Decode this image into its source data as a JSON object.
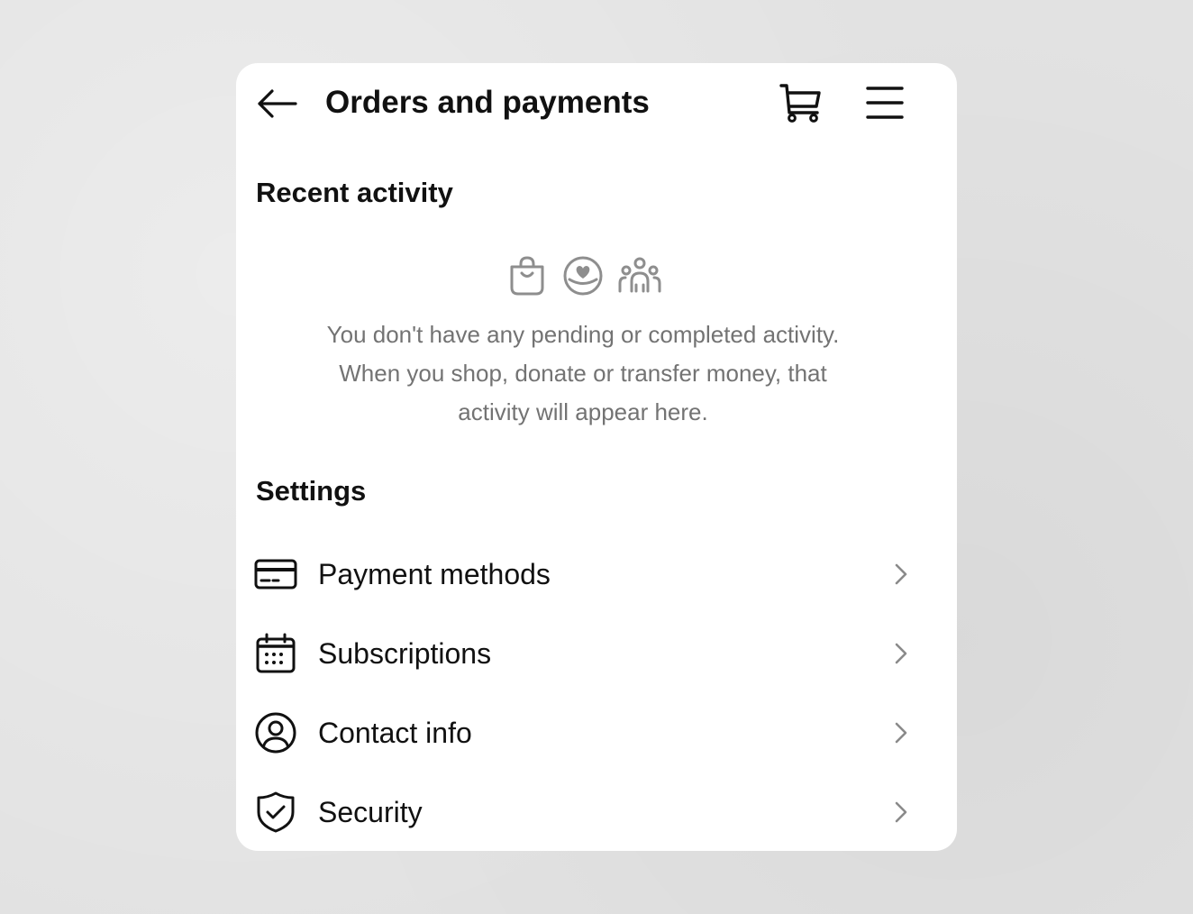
{
  "header": {
    "title": "Orders and payments",
    "back_icon": "arrow-left-icon",
    "cart_icon": "shopping-cart-icon",
    "menu_icon": "hamburger-menu-icon"
  },
  "recent_activity": {
    "heading": "Recent activity",
    "icons": [
      "shopping-bag-icon",
      "donation-heart-icon",
      "people-group-icon"
    ],
    "empty_message_lines": [
      "You don't have any pending or completed activity.",
      "When you shop, donate or transfer money, that",
      "activity will appear here."
    ]
  },
  "settings": {
    "heading": "Settings",
    "items": [
      {
        "label": "Payment methods",
        "icon": "credit-card-icon"
      },
      {
        "label": "Subscriptions",
        "icon": "calendar-icon"
      },
      {
        "label": "Contact info",
        "icon": "user-circle-icon"
      },
      {
        "label": "Security",
        "icon": "shield-check-icon"
      }
    ]
  },
  "colors": {
    "background": "#e2e2e2",
    "card": "#ffffff",
    "primary_text": "#111111",
    "secondary_text": "#737373",
    "muted_icon": "#8e8e8e",
    "chevron": "#8a8a8a"
  }
}
